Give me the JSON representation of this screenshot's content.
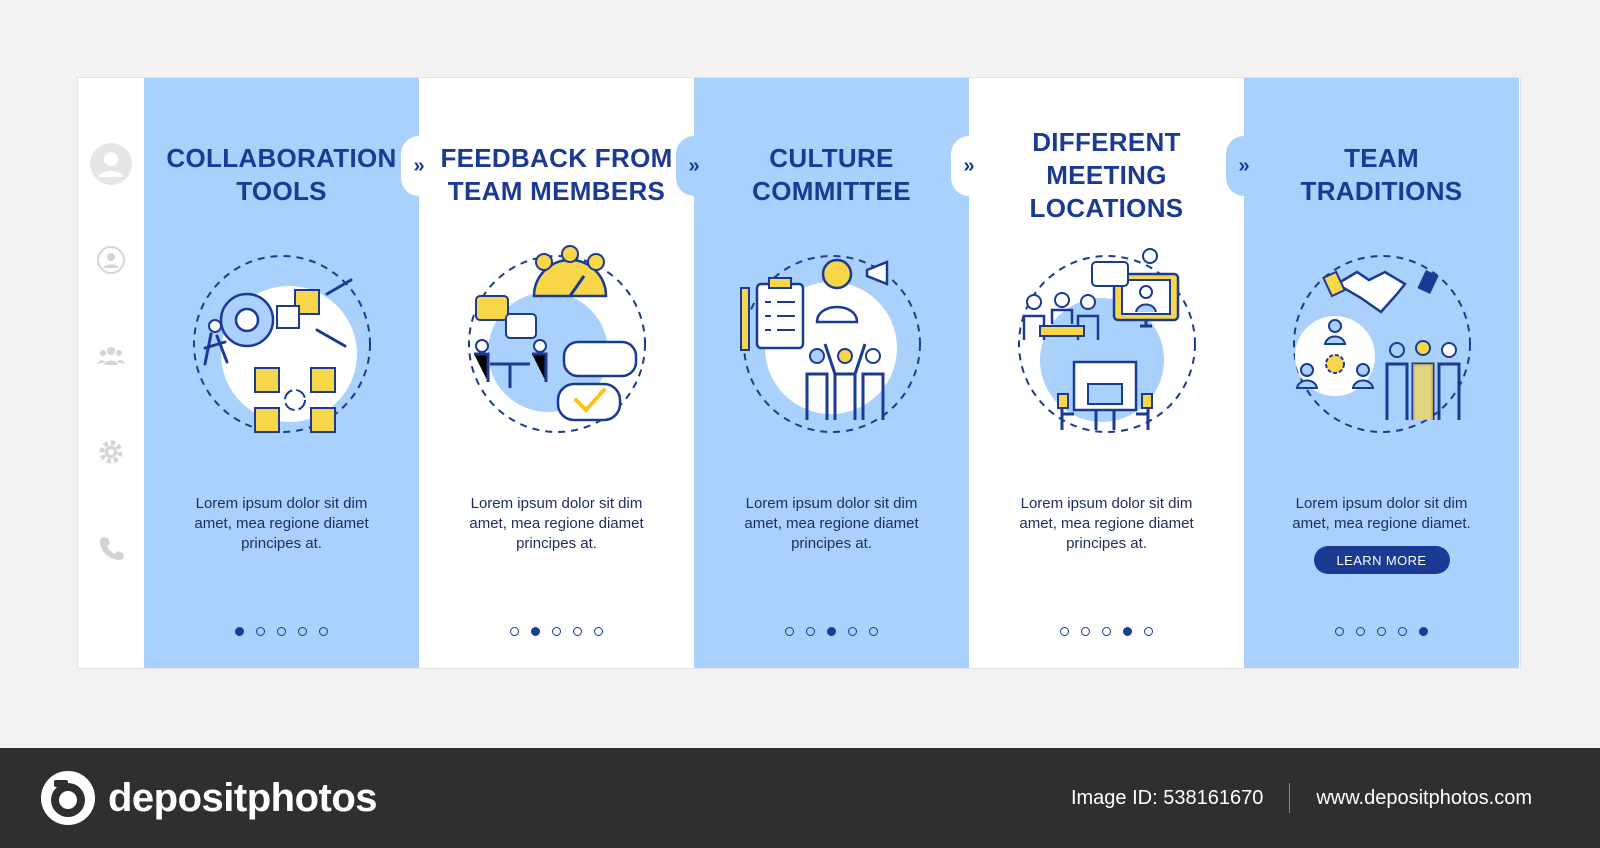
{
  "panels": [
    {
      "title": "COLLABORATION TOOLS",
      "text": "Lorem ipsum dolor sit dim amet, mea regione diamet principes at.",
      "active_dot": 0
    },
    {
      "title": "FEEDBACK FROM TEAM MEMBERS",
      "text": "Lorem ipsum dolor sit dim amet, mea regione diamet principes at.",
      "active_dot": 1
    },
    {
      "title": "CULTURE COMMITTEE",
      "text": "Lorem ipsum dolor sit dim amet, mea regione diamet principes at.",
      "active_dot": 2
    },
    {
      "title": "DIFFERENT MEETING LOCATIONS",
      "text": "Lorem ipsum dolor sit dim amet, mea regione diamet principes at.",
      "active_dot": 3
    },
    {
      "title": "TEAM TRADITIONS",
      "text": "Lorem ipsum dolor sit dim amet, mea regione diamet.",
      "cta": "LEARN MORE",
      "active_dot": 4
    }
  ],
  "next_glyph": "»",
  "icons": {
    "rail": [
      "user-avatar-icon",
      "user-circle-icon",
      "group-icon",
      "gear-icon",
      "phone-icon"
    ],
    "logo": "camera-logo-icon"
  },
  "colors": {
    "blue_panel": "#a9d1fb",
    "navy": "#1b3a93",
    "yellow": "#f7d64a",
    "footer": "#2f2f2f"
  },
  "footer": {
    "brand": "depositphotos",
    "image_id": "Image ID: 538161670",
    "url": "www.depositphotos.com"
  }
}
